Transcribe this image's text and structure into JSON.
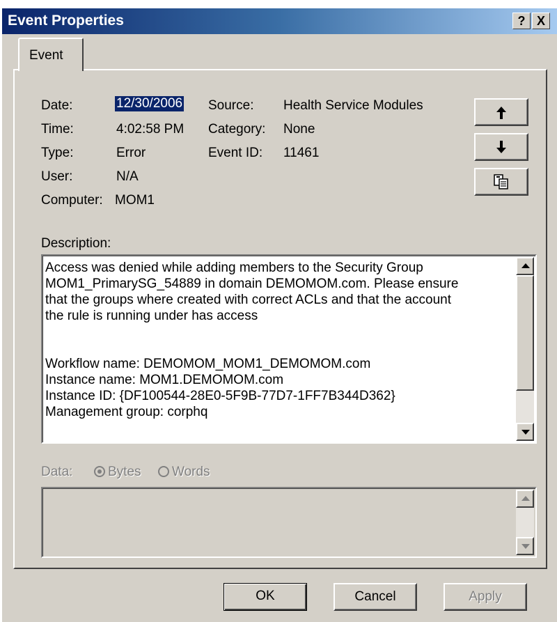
{
  "window": {
    "title": "Event Properties",
    "help_button": "?",
    "close_button": "X"
  },
  "tabs": [
    {
      "label": "Event"
    }
  ],
  "event": {
    "date_label": "Date:",
    "date_value": "12/30/2006",
    "source_label": "Source:",
    "source_value": "Health Service Modules",
    "time_label": "Time:",
    "time_value": "4:02:58 PM",
    "category_label": "Category:",
    "category_value": "None",
    "type_label": "Type:",
    "type_value": "Error",
    "event_id_label": "Event ID:",
    "event_id_value": "11461",
    "user_label": "User:",
    "user_value": "N/A",
    "computer_label": "Computer:",
    "computer_value": "MOM1"
  },
  "nav_buttons": {
    "up_icon": "arrow-up-icon",
    "down_icon": "arrow-down-icon",
    "copy_icon": "copy-icon"
  },
  "description": {
    "label": "Description:",
    "lines": [
      "Access was denied while adding members to the Security Group",
      "MOM1_PrimarySG_54889 in domain DEMOMOM.com. Please ensure",
      "that the groups where created with correct ACLs and that the account",
      "the rule is running under has access",
      "",
      "",
      "Workflow name: DEMOMOM_MOM1_DEMOMOM.com",
      "Instance name: MOM1.DEMOMOM.com",
      "Instance ID: {DF100544-28E0-5F9B-77D7-1FF7B344D362}",
      "Management group: corphq"
    ]
  },
  "data_section": {
    "label": "Data:",
    "bytes_label": "Bytes",
    "words_label": "Words",
    "selected": "Bytes"
  },
  "footer": {
    "ok_label": "OK",
    "cancel_label": "Cancel",
    "apply_label": "Apply"
  }
}
